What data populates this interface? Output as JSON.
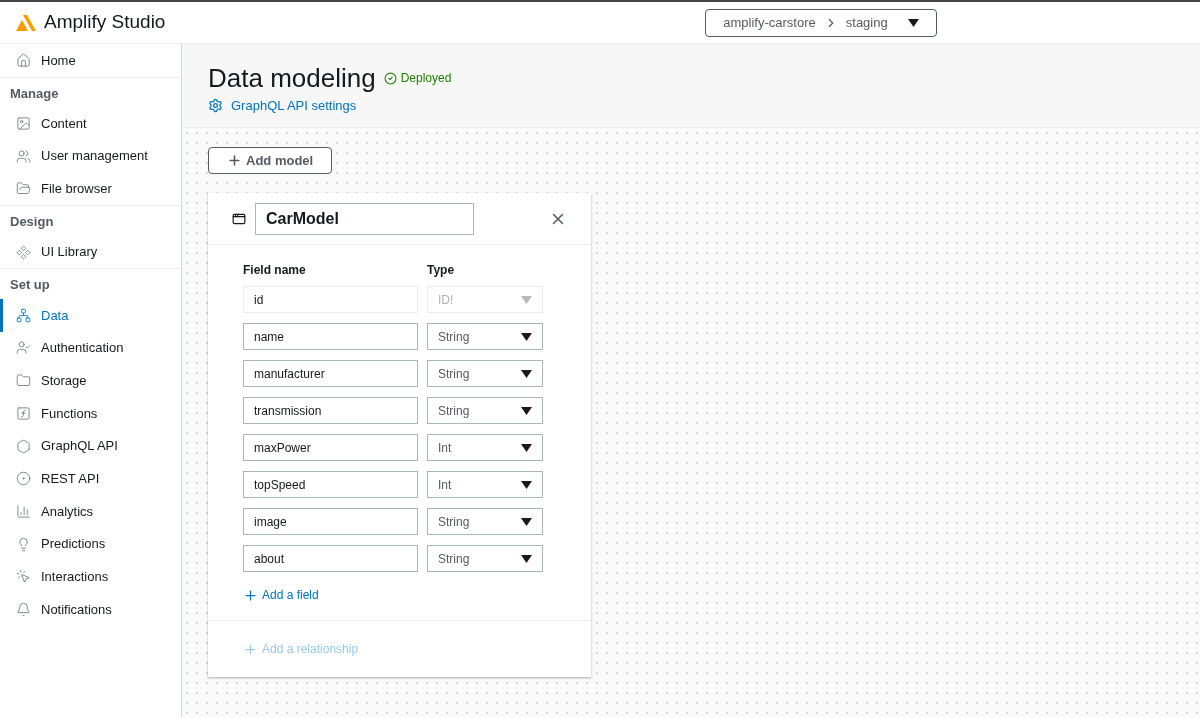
{
  "app": {
    "title": "Amplify Studio"
  },
  "environment": {
    "app": "amplify-carstore",
    "env": "staging"
  },
  "sidebar": [
    {
      "items": [
        {
          "label": "Home",
          "selected": false
        }
      ]
    },
    {
      "heading": "Manage",
      "items": [
        {
          "label": "Content",
          "selected": false
        },
        {
          "label": "User management",
          "selected": false
        },
        {
          "label": "File browser",
          "selected": false
        }
      ]
    },
    {
      "heading": "Design",
      "items": [
        {
          "label": "UI Library",
          "selected": false
        }
      ]
    },
    {
      "heading": "Set up",
      "items": [
        {
          "label": "Data",
          "selected": true
        },
        {
          "label": "Authentication",
          "selected": false
        },
        {
          "label": "Storage",
          "selected": false
        },
        {
          "label": "Functions",
          "selected": false
        },
        {
          "label": "GraphQL API",
          "selected": false
        },
        {
          "label": "REST API",
          "selected": false
        },
        {
          "label": "Analytics",
          "selected": false
        },
        {
          "label": "Predictions",
          "selected": false
        },
        {
          "label": "Interactions",
          "selected": false
        },
        {
          "label": "Notifications",
          "selected": false
        }
      ]
    }
  ],
  "page": {
    "title": "Data modeling",
    "status": "Deployed",
    "settings_link": "GraphQL API settings"
  },
  "add_model_button": "Add model",
  "model": {
    "name": "CarModel",
    "columns": [
      "Field name",
      "Type"
    ],
    "fields": [
      {
        "name": "id",
        "type": "ID!",
        "disabled": true
      },
      {
        "name": "name",
        "type": "String",
        "disabled": false
      },
      {
        "name": "manufacturer",
        "type": "String",
        "disabled": false
      },
      {
        "name": "transmission",
        "type": "String",
        "disabled": false
      },
      {
        "name": "maxPower",
        "type": "Int",
        "disabled": false
      },
      {
        "name": "topSpeed",
        "type": "Int",
        "disabled": false
      },
      {
        "name": "image",
        "type": "String",
        "disabled": false
      },
      {
        "name": "about",
        "type": "String",
        "disabled": false
      }
    ],
    "add_field": {
      "label": "Add a field",
      "disabled": false
    },
    "add_relationship": {
      "label": "Add a relationship",
      "disabled": true
    }
  }
}
